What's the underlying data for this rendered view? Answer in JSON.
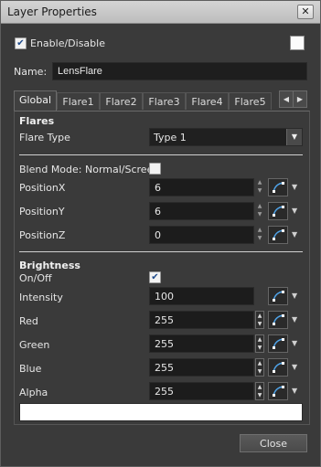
{
  "window": {
    "title": "Layer Properties",
    "close_glyph": "✕"
  },
  "enable": {
    "label": "Enable/Disable",
    "checked": true
  },
  "name": {
    "label": "Name:",
    "value": "LensFlare"
  },
  "tabs": [
    "Global",
    "Flare1",
    "Flare2",
    "Flare3",
    "Flare4",
    "Flare5"
  ],
  "active_tab": "Global",
  "flares": {
    "section": "Flares",
    "flare_type_label": "Flare Type",
    "flare_type_value": "Type 1"
  },
  "blend": {
    "label": "Blend Mode: Normal/Screen",
    "checked": false
  },
  "position": [
    {
      "label": "PositionX",
      "value": "6"
    },
    {
      "label": "PositionY",
      "value": "6"
    },
    {
      "label": "PositionZ",
      "value": "0"
    }
  ],
  "brightness": {
    "section": "Brightness",
    "onoff_label": "On/Off",
    "onoff_checked": true,
    "fields": [
      {
        "label": "Intensity",
        "value": "100"
      },
      {
        "label": "Red",
        "value": "255"
      },
      {
        "label": "Green",
        "value": "255"
      },
      {
        "label": "Blue",
        "value": "255"
      },
      {
        "label": "Alpha",
        "value": "255"
      }
    ]
  },
  "color_swatch": "#ffffff",
  "buttons": {
    "close": "Close"
  },
  "icons": {
    "check": "✔",
    "left_arrow": "◀",
    "right_arrow": "▶",
    "dropdown": "▼",
    "spin_up": "▲",
    "spin_down": "▼"
  }
}
